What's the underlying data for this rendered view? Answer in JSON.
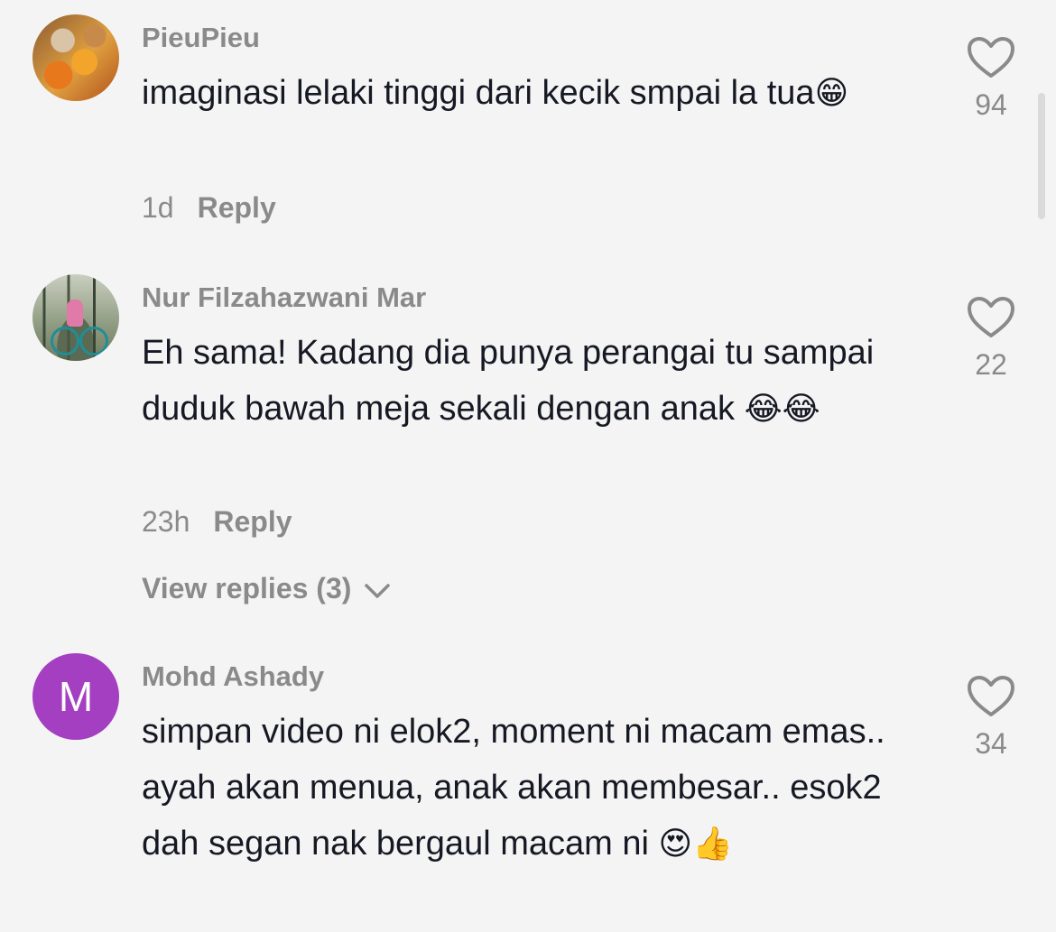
{
  "comments": [
    {
      "username": "PieuPieu",
      "text": "imaginasi lelaki tinggi dari kecik smpai la tua",
      "emoji": "😁",
      "time": "1d",
      "reply_label": "Reply",
      "likes": "94"
    },
    {
      "username": "Nur Filzahazwani Mar",
      "text": "Eh sama! Kadang dia punya perangai tu sampai duduk bawah meja sekali dengan anak",
      "emoji": "😂😂",
      "time": "23h",
      "reply_label": "Reply",
      "likes": "22",
      "view_replies": "View replies (3)"
    },
    {
      "username": "Mohd Ashady",
      "avatar_letter": "M",
      "avatar_color": "#a33fc0",
      "text": "simpan video ni elok2, moment ni macam emas.. ayah akan menua, anak akan membesar.. esok2 dah segan nak bergaul macam ni",
      "emoji": "😍👍",
      "likes": "34"
    }
  ]
}
